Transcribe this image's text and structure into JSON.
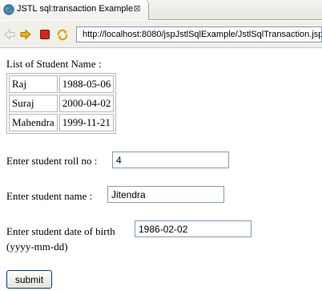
{
  "tab": {
    "title": "JSTL sql:transaction Example",
    "close_glyph": "⊠"
  },
  "toolbar": {
    "url": "http://localhost:8080/jspJstlSqlExample/JstlSqlTransaction.jsp",
    "icons": [
      "back-arrow-icon",
      "forward-arrow-icon",
      "stop-icon",
      "refresh-icon"
    ]
  },
  "page": {
    "list_title": "List of Student Name :",
    "students": [
      {
        "name": "Raj",
        "dob": "1988-05-06"
      },
      {
        "name": "Suraj",
        "dob": "2000-04-02"
      },
      {
        "name": "Mahendra",
        "dob": "1999-11-21"
      }
    ],
    "roll_label": "Enter student roll no :",
    "roll_value": "4",
    "name_label": "Enter student name :",
    "name_value": "Jitendra",
    "dob_label": "Enter student date of birth",
    "dob_value": "1986-02-02",
    "dob_hint": "(yyyy-mm-dd)",
    "submit_label": "submit"
  },
  "colors": {
    "input_border": "#7f9db9",
    "stop": "#cc2a1a",
    "arrow": "#f0b400"
  }
}
